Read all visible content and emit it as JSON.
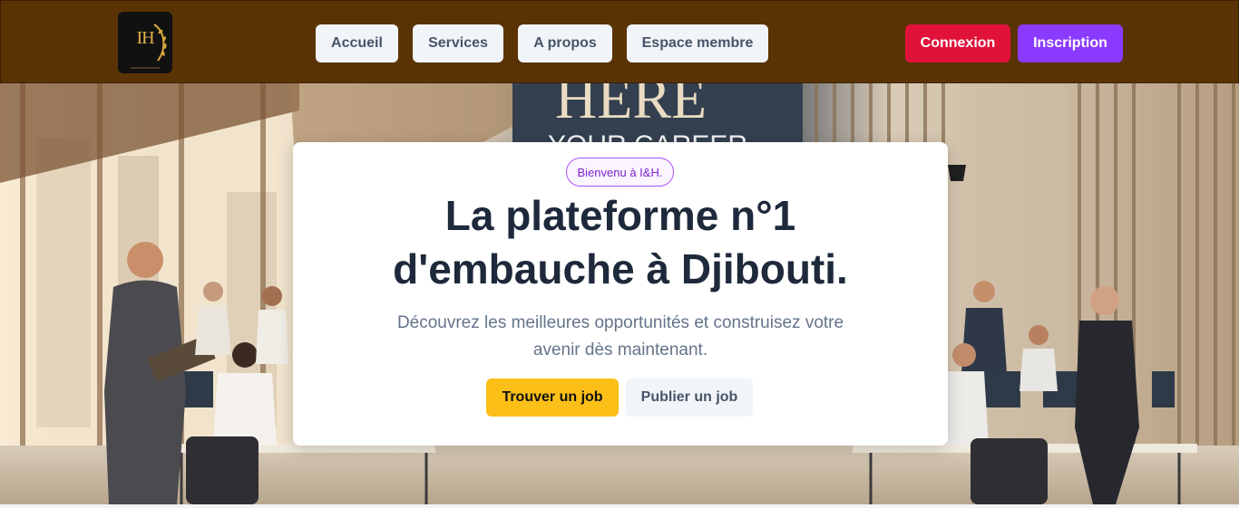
{
  "header": {
    "logo_text": "IH",
    "nav": [
      {
        "label": "Accueil"
      },
      {
        "label": "Services"
      },
      {
        "label": "A propos"
      },
      {
        "label": "Espace membre"
      }
    ],
    "login_label": "Connexion",
    "signup_label": "Inscription"
  },
  "hero": {
    "background_sign": [
      "HERE",
      "YOUR CAREER"
    ],
    "badge": "Bienvenu à I&H.",
    "title_line1": "La plateforme n°1",
    "title_line2": "d'embauche à Djibouti.",
    "subtitle": "Découvrez les meilleures opportunités et construisez votre avenir dès maintenant.",
    "primary_button": "Trouver un job",
    "secondary_button": "Publier un job"
  },
  "colors": {
    "header_bg": "#5a3305",
    "login_bg": "#e0123a",
    "signup_bg": "#8b3bff",
    "primary_cta": "#fbbf17",
    "badge_accent": "#a855f7",
    "title_text": "#1e293b"
  }
}
